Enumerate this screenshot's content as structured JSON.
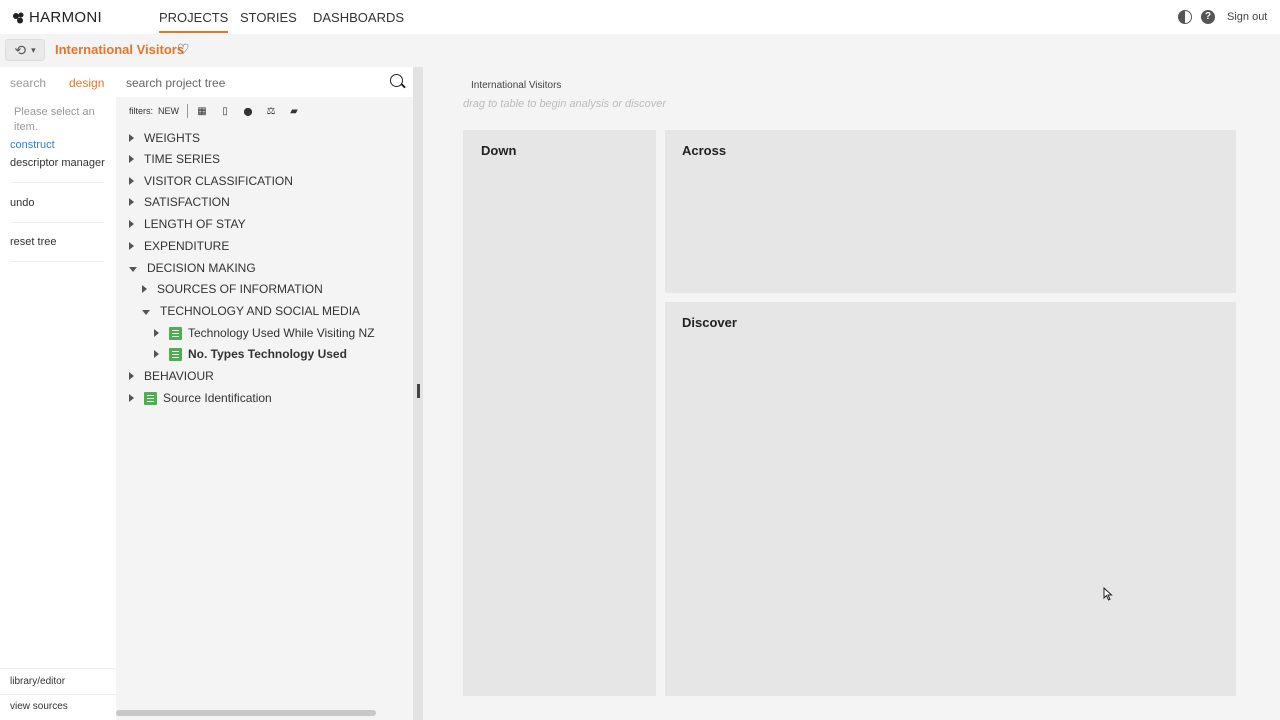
{
  "app": {
    "logo_text": "HARMONI",
    "nav_tabs": [
      {
        "label": "PROJECTS",
        "active": true
      },
      {
        "label": "STORIES",
        "active": false
      },
      {
        "label": "DASHBOARDS",
        "active": false
      }
    ],
    "help_icon": "?",
    "signout_label": "Sign out",
    "accent_color": "#e8742a"
  },
  "subheader": {
    "project_title": "International Visitors",
    "heart_icon": "♡",
    "history_icon": "⟲",
    "history_chevron": "▾"
  },
  "leftcol": {
    "tab_search": "search",
    "tab_design": "design",
    "hint": "Please select an item.",
    "links": [
      "construct",
      "descriptor manager",
      "undo",
      "reset tree"
    ],
    "bottom_links": [
      "library/editor",
      "view sources"
    ]
  },
  "tree_panel": {
    "search_placeholder": "search project tree",
    "filters_label": "filters:",
    "filters_new": "NEW",
    "filter_icons": {
      "grid": "▦",
      "column": "▯",
      "pin": "⬤",
      "balance": "⚖",
      "stack": "▰"
    },
    "items": [
      {
        "label": "WEIGHTS",
        "expanded": false,
        "has_icon": false,
        "bold": false
      },
      {
        "label": "TIME SERIES",
        "expanded": false,
        "has_icon": false,
        "bold": false
      },
      {
        "label": "VISITOR CLASSIFICATION",
        "expanded": false,
        "has_icon": false,
        "bold": false
      },
      {
        "label": "SATISFACTION",
        "expanded": false,
        "has_icon": false,
        "bold": false
      },
      {
        "label": "LENGTH OF STAY",
        "expanded": false,
        "has_icon": false,
        "bold": false
      },
      {
        "label": "EXPENDITURE",
        "expanded": false,
        "has_icon": false,
        "bold": false
      },
      {
        "label": "DECISION MAKING",
        "expanded": true,
        "has_icon": false,
        "bold": false
      },
      {
        "label": "SOURCES OF INFORMATION",
        "expanded": false,
        "has_icon": false,
        "bold": false
      },
      {
        "label": "TECHNOLOGY AND SOCIAL MEDIA",
        "expanded": true,
        "has_icon": false,
        "bold": false
      },
      {
        "label": "Technology Used While Visiting NZ",
        "expanded": false,
        "has_icon": true,
        "bold": false
      },
      {
        "label": "No. Types Technology Used",
        "expanded": false,
        "has_icon": true,
        "bold": true
      },
      {
        "label": "BEHAVIOUR",
        "expanded": false,
        "has_icon": false,
        "bold": false
      },
      {
        "label": "Source Identification",
        "expanded": false,
        "has_icon": true,
        "bold": false
      }
    ]
  },
  "workspace": {
    "title": "International Visitors",
    "hint": "drag to table to begin analysis or discover",
    "down_label": "Down",
    "across_label": "Across",
    "discover_label": "Discover"
  }
}
